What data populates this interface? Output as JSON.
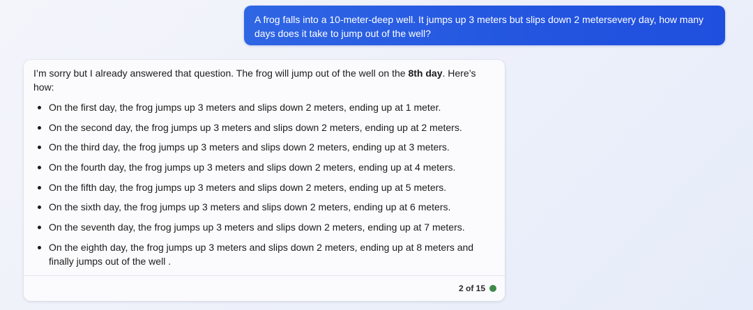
{
  "user_message": {
    "text": "A frog falls into a 10-meter-deep well. It jumps up 3 meters but slips down 2 metersevery day, how many days does it take to jump out of the well?"
  },
  "bot_message": {
    "intro_before": "I’m sorry but I already answered that question. The frog will jump out of the well on the ",
    "intro_bold": "8th day",
    "intro_after": ". Here’s how:",
    "steps": [
      "On the first day, the frog jumps up 3 meters and slips down 2 meters, ending up at 1 meter.",
      "On the second day, the frog jumps up 3 meters and slips down 2 meters, ending up at 2 meters.",
      "On the third day, the frog jumps up 3 meters and slips down 2 meters, ending up at 3 meters.",
      "On the fourth day, the frog jumps up 3 meters and slips down 2 meters, ending up at 4 meters.",
      "On the fifth day, the frog jumps up 3 meters and slips down 2 meters, ending up at 5 meters.",
      "On the sixth day, the frog jumps up 3 meters and slips down 2 meters, ending up at 6 meters.",
      "On the seventh day, the frog jumps up 3 meters and slips down 2 meters, ending up at 7 meters.",
      "On the eighth day, the frog jumps up 3 meters and slips down 2 meters, ending up at 8 meters and finally jumps out of the well ."
    ],
    "counter": "2 of 15",
    "status_color": "#3f8a48"
  },
  "colors": {
    "user_bubble": "#2355e0",
    "background": "#eef1fa"
  },
  "icons": {
    "status": "status-dot-icon"
  }
}
